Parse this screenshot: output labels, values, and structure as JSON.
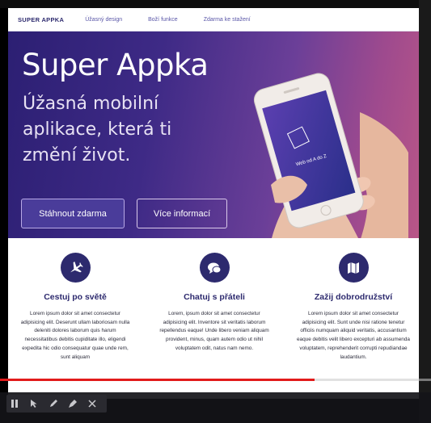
{
  "nav": {
    "brand": "SUPER APPKA",
    "links": [
      "Úžasný design",
      "Boží funkce",
      "Zdarma ke stažení"
    ]
  },
  "hero": {
    "title": "Super Appka",
    "subtitle": "Úžasná mobilní aplikace, která ti změní život.",
    "primary_button": "Stáhnout zdarma",
    "secondary_button": "Více informací",
    "phone_screen_text": "Web od A do Z"
  },
  "features": [
    {
      "icon": "airplane-icon",
      "title": "Cestuj po světě",
      "text": "Lorem ipsum dolor sit amet consectetur adipisicing elit. Deserunt ullam laboriosam nulla deleniti dolores laborum quis harum necessitatibus debitis cupiditate illo, eligendi expedita hic odio consequatur quae unde rem, sunt aliquam"
    },
    {
      "icon": "chat-icon",
      "title": "Chatuj s přáteli",
      "text": "Lorem, ipsum dolor sit amet consectetur adipisicing elit. Inventore sit veritatis laborum repellendus eaque! Unde libero veniam aliquam provident, minus, quam autem odio ut nihil voluptatem odit, natus nam nemo."
    },
    {
      "icon": "map-icon",
      "title": "Zažij dobrodružství",
      "text": "Lorem ipsum dolor sit amet consectetur adipisicing elit. Sunt unde nisi ratione tenetur officiis numquam aliquid veritatis, accusantium eaque debitis velit libero excepturi ab assumenda voluptatem, reprehenderit corrupti repudiandae laudantium."
    }
  ],
  "video": {
    "progress": 0.73
  },
  "colors": {
    "brand": "#2d2a6e",
    "accent": "#4a3c9a",
    "progress": "#e21b1b"
  }
}
